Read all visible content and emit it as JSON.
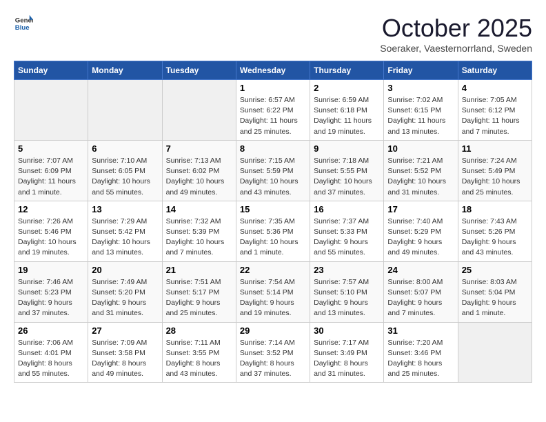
{
  "header": {
    "logo": {
      "general": "General",
      "blue": "Blue"
    },
    "title": "October 2025",
    "subtitle": "Soeraker, Vaesternorrland, Sweden"
  },
  "days_of_week": [
    "Sunday",
    "Monday",
    "Tuesday",
    "Wednesday",
    "Thursday",
    "Friday",
    "Saturday"
  ],
  "weeks": [
    [
      {
        "day": "",
        "info": ""
      },
      {
        "day": "",
        "info": ""
      },
      {
        "day": "",
        "info": ""
      },
      {
        "day": "1",
        "info": "Sunrise: 6:57 AM\nSunset: 6:22 PM\nDaylight: 11 hours\nand 25 minutes."
      },
      {
        "day": "2",
        "info": "Sunrise: 6:59 AM\nSunset: 6:18 PM\nDaylight: 11 hours\nand 19 minutes."
      },
      {
        "day": "3",
        "info": "Sunrise: 7:02 AM\nSunset: 6:15 PM\nDaylight: 11 hours\nand 13 minutes."
      },
      {
        "day": "4",
        "info": "Sunrise: 7:05 AM\nSunset: 6:12 PM\nDaylight: 11 hours\nand 7 minutes."
      }
    ],
    [
      {
        "day": "5",
        "info": "Sunrise: 7:07 AM\nSunset: 6:09 PM\nDaylight: 11 hours\nand 1 minute."
      },
      {
        "day": "6",
        "info": "Sunrise: 7:10 AM\nSunset: 6:05 PM\nDaylight: 10 hours\nand 55 minutes."
      },
      {
        "day": "7",
        "info": "Sunrise: 7:13 AM\nSunset: 6:02 PM\nDaylight: 10 hours\nand 49 minutes."
      },
      {
        "day": "8",
        "info": "Sunrise: 7:15 AM\nSunset: 5:59 PM\nDaylight: 10 hours\nand 43 minutes."
      },
      {
        "day": "9",
        "info": "Sunrise: 7:18 AM\nSunset: 5:55 PM\nDaylight: 10 hours\nand 37 minutes."
      },
      {
        "day": "10",
        "info": "Sunrise: 7:21 AM\nSunset: 5:52 PM\nDaylight: 10 hours\nand 31 minutes."
      },
      {
        "day": "11",
        "info": "Sunrise: 7:24 AM\nSunset: 5:49 PM\nDaylight: 10 hours\nand 25 minutes."
      }
    ],
    [
      {
        "day": "12",
        "info": "Sunrise: 7:26 AM\nSunset: 5:46 PM\nDaylight: 10 hours\nand 19 minutes."
      },
      {
        "day": "13",
        "info": "Sunrise: 7:29 AM\nSunset: 5:42 PM\nDaylight: 10 hours\nand 13 minutes."
      },
      {
        "day": "14",
        "info": "Sunrise: 7:32 AM\nSunset: 5:39 PM\nDaylight: 10 hours\nand 7 minutes."
      },
      {
        "day": "15",
        "info": "Sunrise: 7:35 AM\nSunset: 5:36 PM\nDaylight: 10 hours\nand 1 minute."
      },
      {
        "day": "16",
        "info": "Sunrise: 7:37 AM\nSunset: 5:33 PM\nDaylight: 9 hours\nand 55 minutes."
      },
      {
        "day": "17",
        "info": "Sunrise: 7:40 AM\nSunset: 5:29 PM\nDaylight: 9 hours\nand 49 minutes."
      },
      {
        "day": "18",
        "info": "Sunrise: 7:43 AM\nSunset: 5:26 PM\nDaylight: 9 hours\nand 43 minutes."
      }
    ],
    [
      {
        "day": "19",
        "info": "Sunrise: 7:46 AM\nSunset: 5:23 PM\nDaylight: 9 hours\nand 37 minutes."
      },
      {
        "day": "20",
        "info": "Sunrise: 7:49 AM\nSunset: 5:20 PM\nDaylight: 9 hours\nand 31 minutes."
      },
      {
        "day": "21",
        "info": "Sunrise: 7:51 AM\nSunset: 5:17 PM\nDaylight: 9 hours\nand 25 minutes."
      },
      {
        "day": "22",
        "info": "Sunrise: 7:54 AM\nSunset: 5:14 PM\nDaylight: 9 hours\nand 19 minutes."
      },
      {
        "day": "23",
        "info": "Sunrise: 7:57 AM\nSunset: 5:10 PM\nDaylight: 9 hours\nand 13 minutes."
      },
      {
        "day": "24",
        "info": "Sunrise: 8:00 AM\nSunset: 5:07 PM\nDaylight: 9 hours\nand 7 minutes."
      },
      {
        "day": "25",
        "info": "Sunrise: 8:03 AM\nSunset: 5:04 PM\nDaylight: 9 hours\nand 1 minute."
      }
    ],
    [
      {
        "day": "26",
        "info": "Sunrise: 7:06 AM\nSunset: 4:01 PM\nDaylight: 8 hours\nand 55 minutes."
      },
      {
        "day": "27",
        "info": "Sunrise: 7:09 AM\nSunset: 3:58 PM\nDaylight: 8 hours\nand 49 minutes."
      },
      {
        "day": "28",
        "info": "Sunrise: 7:11 AM\nSunset: 3:55 PM\nDaylight: 8 hours\nand 43 minutes."
      },
      {
        "day": "29",
        "info": "Sunrise: 7:14 AM\nSunset: 3:52 PM\nDaylight: 8 hours\nand 37 minutes."
      },
      {
        "day": "30",
        "info": "Sunrise: 7:17 AM\nSunset: 3:49 PM\nDaylight: 8 hours\nand 31 minutes."
      },
      {
        "day": "31",
        "info": "Sunrise: 7:20 AM\nSunset: 3:46 PM\nDaylight: 8 hours\nand 25 minutes."
      },
      {
        "day": "",
        "info": ""
      }
    ]
  ]
}
